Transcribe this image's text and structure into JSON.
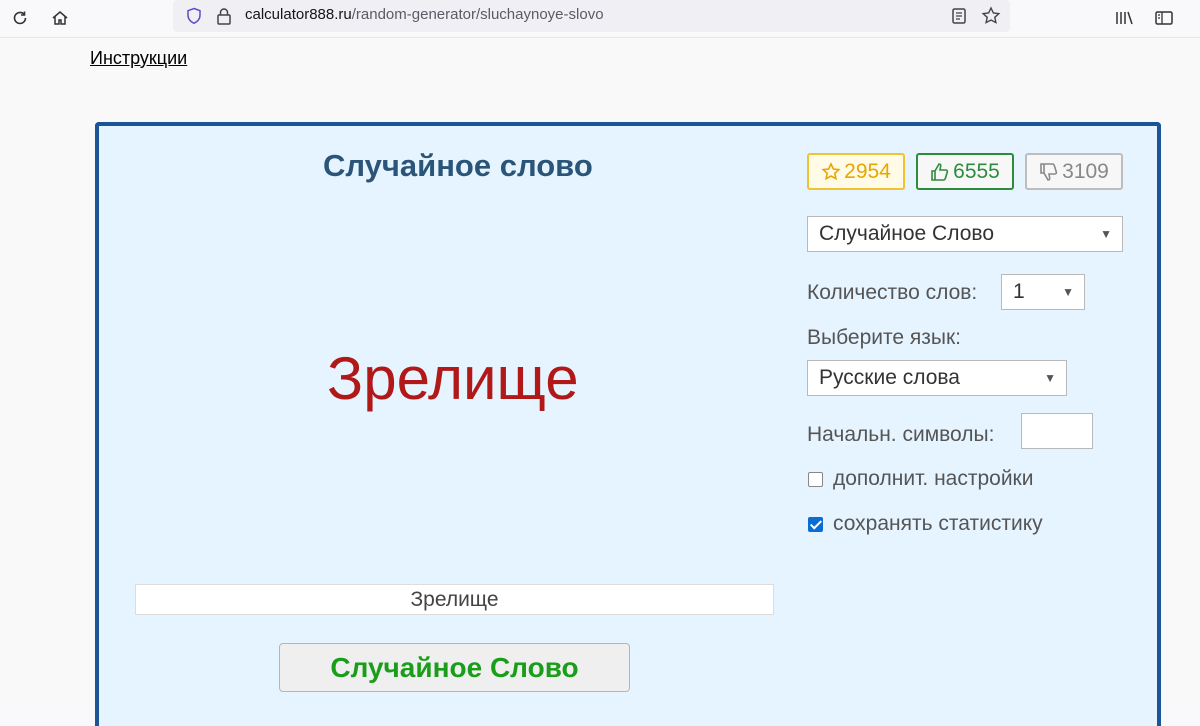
{
  "browser": {
    "url_host": "calculator888.ru",
    "url_path": "/random-generator/sluchaynoye-slovo"
  },
  "page": {
    "instructions_link": "Инструкции"
  },
  "generator": {
    "title": "Случайное слово",
    "generated_word": "Зрелище",
    "result_field": "Зрелище",
    "generate_button": "Случайное Слово"
  },
  "votes": {
    "favorites": "2954",
    "likes": "6555",
    "dislikes": "3109"
  },
  "settings": {
    "type_select": "Случайное Слово",
    "count_label": "Количество слов:",
    "count_value": "1",
    "language_label": "Выберите язык:",
    "language_value": "Русские слова",
    "start_chars_label": "Начальн. символы:",
    "start_chars_value": "",
    "extra_settings_label": "дополнит. настройки",
    "extra_settings_checked": false,
    "save_stats_label": "сохранять статистику",
    "save_stats_checked": true
  },
  "colors": {
    "panel_border": "#1b5597",
    "panel_bg": "#e6f4ff",
    "word_color": "#b11818",
    "button_text": "#1a9e1a"
  }
}
